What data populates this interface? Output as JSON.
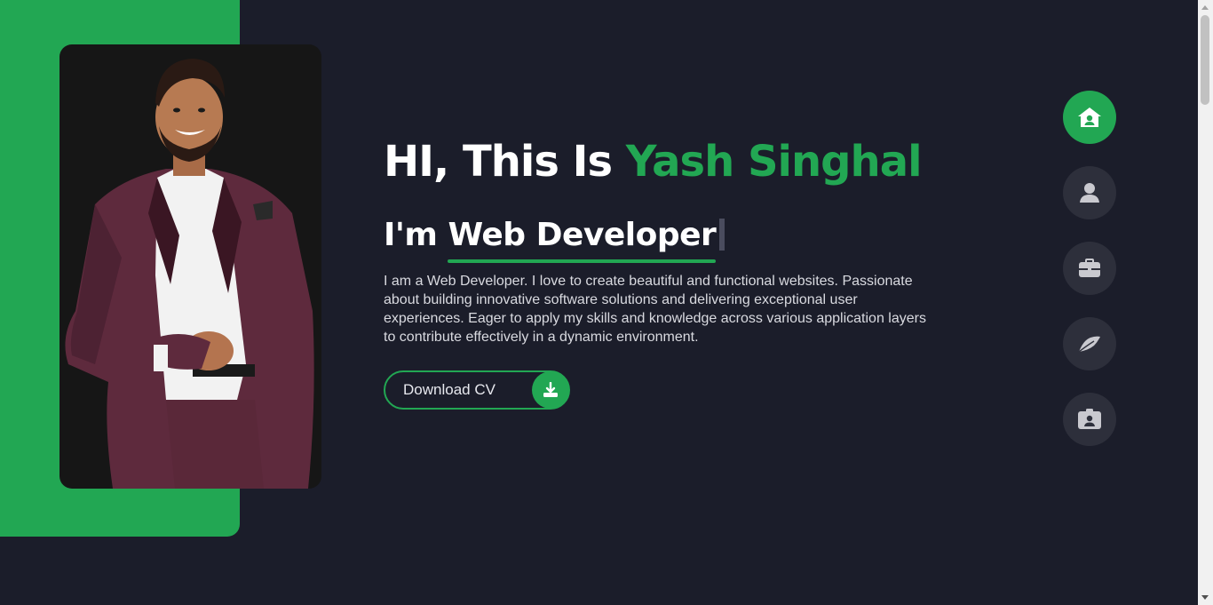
{
  "hero": {
    "greeting_prefix": "HI, This Is ",
    "name": "Yash Singhal",
    "role_prefix": "I'm",
    "role_typed": "Web Developer",
    "bio": "I am a Web Developer. I love to create beautiful and functional websites. Passionate about building innovative software solutions and delivering exceptional user experiences. Eager to apply my skills and knowledge across various application layers to contribute effectively in a dynamic environment.",
    "cv_button_label": "Download CV"
  },
  "nav": {
    "items": [
      {
        "icon": "house-user-icon",
        "active": true
      },
      {
        "icon": "user-icon",
        "active": false
      },
      {
        "icon": "briefcase-icon",
        "active": false
      },
      {
        "icon": "feather-icon",
        "active": false
      },
      {
        "icon": "contact-card-icon",
        "active": false
      }
    ]
  },
  "colors": {
    "accent": "#22a753",
    "background": "#1b1d2a",
    "nav_button": "#2d2f3b",
    "text": "#ffffff"
  }
}
